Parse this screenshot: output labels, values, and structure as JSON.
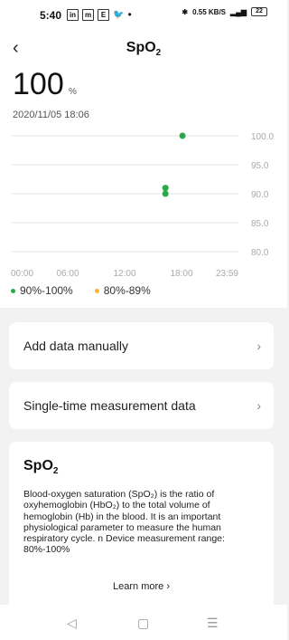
{
  "status": {
    "time": "5:40",
    "icons": [
      "in",
      "m",
      "E"
    ],
    "speed": "0.55 KB/S",
    "battery": "22"
  },
  "header": {
    "title": "SpO",
    "title_sub": "2"
  },
  "reading": {
    "value": "100",
    "unit": "%",
    "timestamp": "2020/11/05 18:06"
  },
  "chart_data": {
    "type": "scatter",
    "x_ticks": [
      "00:00",
      "06:00",
      "12:00",
      "18:00",
      "23:59"
    ],
    "y_ticks": [
      "100.0",
      "95.0",
      "90.0",
      "85.0",
      "80.0"
    ],
    "ylim": [
      80,
      100
    ],
    "xlim": [
      0,
      24
    ],
    "points": [
      {
        "x": 18.1,
        "y": 100,
        "color": "#2aa84a"
      },
      {
        "x": 16.3,
        "y": 91,
        "color": "#2aa84a"
      },
      {
        "x": 16.3,
        "y": 90,
        "color": "#2aa84a"
      }
    ]
  },
  "legend": [
    {
      "label": "90%-100%",
      "color": "#2aa84a"
    },
    {
      "label": "80%-89%",
      "color": "#f5b82e"
    }
  ],
  "rows": {
    "add": "Add data manually",
    "single": "Single-time measurement data"
  },
  "info": {
    "title": "SpO",
    "title_sub": "2",
    "text": "Blood-oxygen saturation (SpO₂) is the ratio of oxyhemoglobin (HbO₂) to the total volume of hemoglobin (Hb) in the blood. It is an important physiological parameter to measure the human respiratory cycle.  n Device measurement range: 80%-100%",
    "learn_more": "Learn more"
  },
  "nav": {
    "back": "◁",
    "home": "▢",
    "menu": "☰"
  }
}
